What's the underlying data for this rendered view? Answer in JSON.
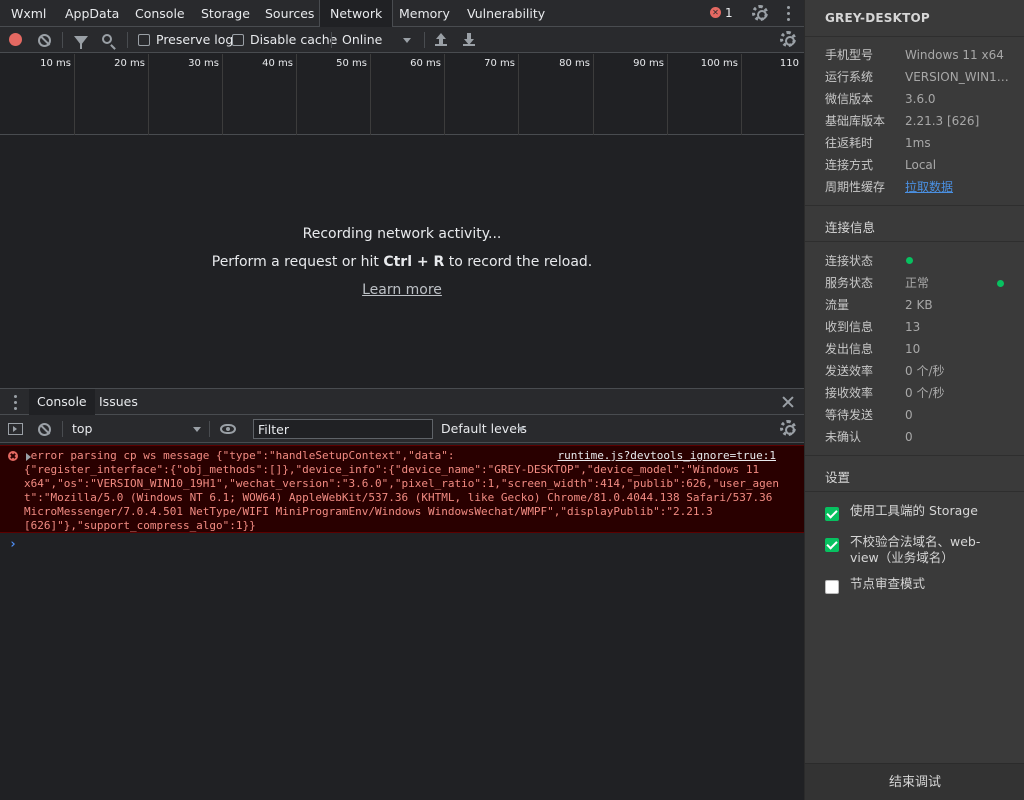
{
  "tabs": [
    "Wxml",
    "AppData",
    "Console",
    "Storage",
    "Sources",
    "Network",
    "Memory",
    "Vulnerability"
  ],
  "error_badge": "✕",
  "error_count": "1",
  "toolbar": {
    "preserve_log": "Preserve log",
    "disable_cache": "Disable cache",
    "throttle": "Online"
  },
  "timeline_ticks": [
    "10 ms",
    "20 ms",
    "30 ms",
    "40 ms",
    "50 ms",
    "60 ms",
    "70 ms",
    "80 ms",
    "90 ms",
    "100 ms",
    "110"
  ],
  "network_empty": {
    "line1": "Recording network activity...",
    "line2_pre": "Perform a request or hit ",
    "line2_key": "Ctrl + R",
    "line2_post": " to record the reload.",
    "learn_more": "Learn more"
  },
  "drawer": {
    "tab_console": "Console",
    "tab_issues": "Issues"
  },
  "console_bar": {
    "context": "top",
    "filter_placeholder": "Filter",
    "levels": "Default levels"
  },
  "console_error": {
    "text": " error parsing cp ws message {\"type\":\"handleSetupContext\",\"data\":\n{\"register_interface\":{\"obj_methods\":[]},\"device_info\":{\"device_name\":\"GREY-DESKTOP\",\"device_model\":\"Windows 11\nx64\",\"os\":\"VERSION_WIN10_19H1\",\"wechat_version\":\"3.6.0\",\"pixel_ratio\":1,\"screen_width\":414,\"publib\":626,\"user_agen\nt\":\"Mozilla/5.0 (Windows NT 6.1; WOW64) AppleWebKit/537.36 (KHTML, like Gecko) Chrome/81.0.4044.138 Safari/537.36\nMicroMessenger/7.0.4.501 NetType/WIFI MiniProgramEnv/Windows WindowsWechat/WMPF\",\"displayPublib\":\"2.21.3\n[626]\"},\"support_compress_algo\":1}}",
    "source_link": "runtime.js?devtools_ignore=true:1"
  },
  "right_panel": {
    "title": "GREY-DESKTOP",
    "device_rows": [
      {
        "k": "手机型号",
        "v": "Windows 11 x64"
      },
      {
        "k": "运行系统",
        "v": "VERSION_WIN10..."
      },
      {
        "k": "微信版本",
        "v": "3.6.0"
      },
      {
        "k": "基础库版本",
        "v": "2.21.3 [626]"
      },
      {
        "k": "往返耗时",
        "v": "1ms"
      },
      {
        "k": "连接方式",
        "v": "Local"
      },
      {
        "k": "周期性缓存",
        "v": "拉取数据"
      }
    ],
    "conn_title": "连接信息",
    "conn_rows": [
      {
        "k": "连接状态",
        "v": ""
      },
      {
        "k": "服务状态",
        "v": "正常"
      },
      {
        "k": "流量",
        "v": "2 KB"
      },
      {
        "k": "收到信息",
        "v": "13"
      },
      {
        "k": "发出信息",
        "v": "10"
      },
      {
        "k": "发送效率",
        "v": "0 个/秒"
      },
      {
        "k": "接收效率",
        "v": "0 个/秒"
      },
      {
        "k": "等待发送",
        "v": "0"
      },
      {
        "k": "未确认",
        "v": "0"
      }
    ],
    "settings_title": "设置",
    "settings": [
      {
        "label": "使用工具端的 Storage",
        "checked": true
      },
      {
        "label": "不校验合法域名、web-view（业务域名）",
        "checked": true
      },
      {
        "label": "节点审查模式",
        "checked": false
      }
    ],
    "footer": "结束调试",
    "status_color": "#07c160",
    "link_color": "#4a90e2"
  }
}
